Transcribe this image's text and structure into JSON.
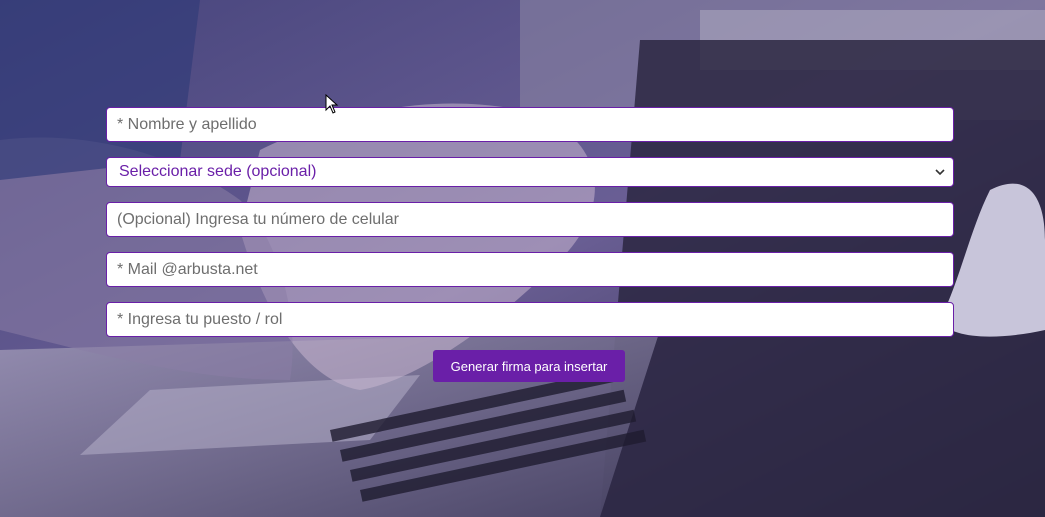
{
  "form": {
    "name_placeholder": "* Nombre y apellido",
    "sede_select_value": "Seleccionar sede (opcional)",
    "phone_placeholder": "(Opcional) Ingresa tu número de celular",
    "mail_placeholder": "* Mail @arbusta.net",
    "role_placeholder": "* Ingresa tu puesto / rol",
    "submit_label": "Generar firma para insertar"
  },
  "icons": {
    "select_caret": "chevron-down-icon",
    "mouse_cursor": "arrow-cursor-icon"
  },
  "colors": {
    "accent": "#6a1fa8",
    "field_background": "#ffffff",
    "placeholder_text": "#6e6e6e",
    "button_text": "#ffffff"
  }
}
